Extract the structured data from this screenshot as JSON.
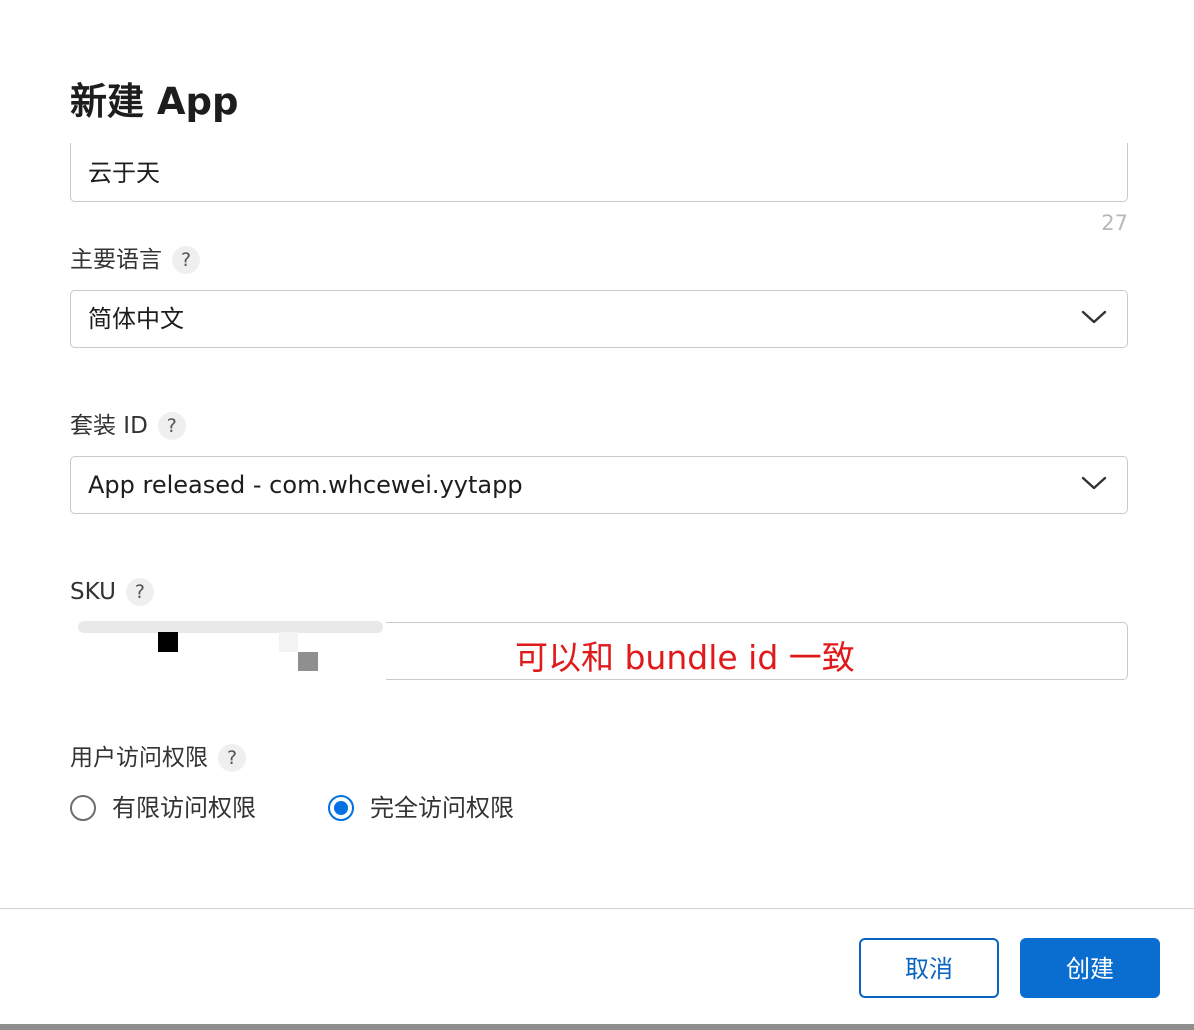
{
  "dialog": {
    "title": "新建 App"
  },
  "name_field": {
    "value": "云于天",
    "counter": "27"
  },
  "primary_language": {
    "label": "主要语言",
    "help": "?",
    "selected": "简体中文"
  },
  "bundle_id": {
    "label": "套装 ID",
    "help": "?",
    "selected": "App released - com.whcewei.yytapp"
  },
  "sku": {
    "label": "SKU",
    "help": "?",
    "value": "",
    "annotation": "可以和 bundle id 一致",
    "annotation_color": "#e0191b"
  },
  "user_access": {
    "label": "用户访问权限",
    "help": "?",
    "options": [
      {
        "label": "有限访问权限",
        "selected": false
      },
      {
        "label": "完全访问权限",
        "selected": true
      }
    ]
  },
  "footer": {
    "cancel_label": "取消",
    "create_label": "创建"
  },
  "colors": {
    "accent": "#0a6ed1",
    "radio_selected": "#0071e3"
  }
}
